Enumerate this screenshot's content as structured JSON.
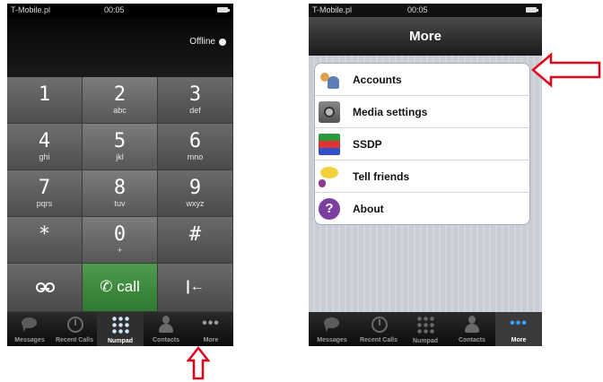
{
  "left_phone": {
    "status": {
      "carrier": "T-Mobile.pl",
      "time": "00:05"
    },
    "offline_label": "Offline",
    "keys": [
      {
        "digit": "1",
        "letters": ""
      },
      {
        "digit": "2",
        "letters": "abc"
      },
      {
        "digit": "3",
        "letters": "def"
      },
      {
        "digit": "4",
        "letters": "ghi"
      },
      {
        "digit": "5",
        "letters": "jkl"
      },
      {
        "digit": "6",
        "letters": "mno"
      },
      {
        "digit": "7",
        "letters": "pqrs"
      },
      {
        "digit": "8",
        "letters": "tuv"
      },
      {
        "digit": "9",
        "letters": "wxyz"
      },
      {
        "digit": "*",
        "letters": ""
      },
      {
        "digit": "0",
        "letters": "+"
      },
      {
        "digit": "#",
        "letters": ""
      }
    ],
    "call_label": "call",
    "tabs": [
      "Messages",
      "Recent Calls",
      "Numpad",
      "Contacts",
      "More"
    ],
    "active_tab": "Numpad"
  },
  "right_phone": {
    "status": {
      "carrier": "T-Mobile.pl",
      "time": "00:05"
    },
    "title": "More",
    "menu": [
      "Accounts",
      "Media settings",
      "SSDP",
      "Tell friends",
      "About"
    ],
    "tabs": [
      "Messages",
      "Recent Calls",
      "Numpad",
      "Contacts",
      "More"
    ],
    "active_tab": "More"
  },
  "colors": {
    "arrow": "#e2001a",
    "call_green": "#3b8a3b"
  }
}
